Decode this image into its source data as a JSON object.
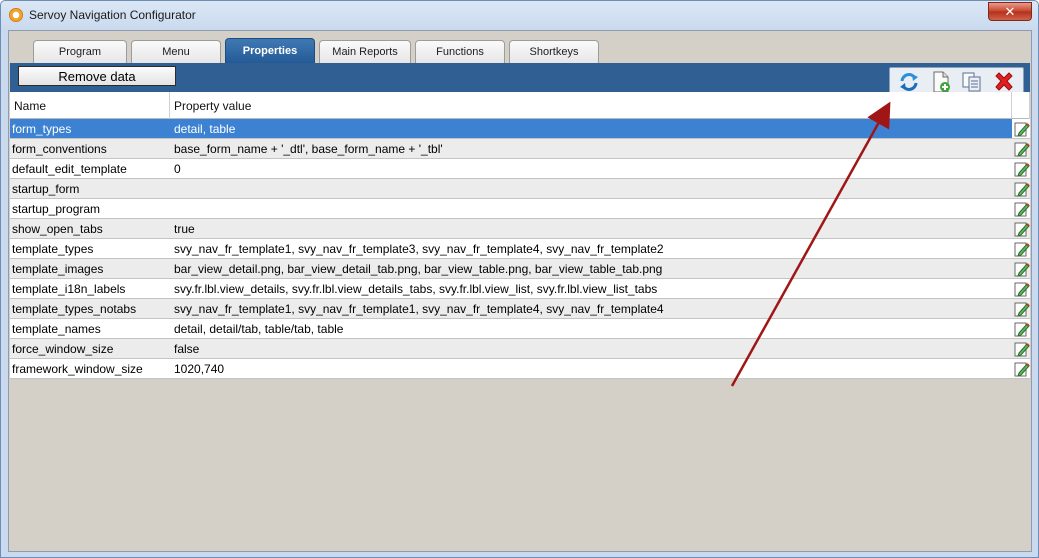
{
  "window": {
    "title": "Servoy Navigation Configurator",
    "close_label": "✕"
  },
  "tabs": [
    {
      "label": "Program",
      "width": 94,
      "active": false
    },
    {
      "label": "Menu",
      "width": 90,
      "active": false
    },
    {
      "label": "Properties",
      "width": 90,
      "active": true
    },
    {
      "label": "Main Reports",
      "width": 92,
      "active": false
    },
    {
      "label": "Functions",
      "width": 90,
      "active": false
    },
    {
      "label": "Shortkeys",
      "width": 90,
      "active": false
    }
  ],
  "remove_button_label": "Remove data",
  "toolbar_icons": [
    "refresh-icon",
    "add-document-icon",
    "copy-icon",
    "delete-icon"
  ],
  "table": {
    "headers": {
      "name": "Name",
      "value": "Property value"
    },
    "rows": [
      {
        "name": "form_types",
        "value": "detail, table"
      },
      {
        "name": "form_conventions",
        "value": "base_form_name + '_dtl', base_form_name + '_tbl'"
      },
      {
        "name": "default_edit_template",
        "value": "0"
      },
      {
        "name": "startup_form",
        "value": ""
      },
      {
        "name": "startup_program",
        "value": ""
      },
      {
        "name": "show_open_tabs",
        "value": "true"
      },
      {
        "name": "template_types",
        "value": "svy_nav_fr_template1, svy_nav_fr_template3, svy_nav_fr_template4, svy_nav_fr_template2"
      },
      {
        "name": "template_images",
        "value": "bar_view_detail.png, bar_view_detail_tab.png, bar_view_table.png, bar_view_table_tab.png"
      },
      {
        "name": "template_i18n_labels",
        "value": "svy.fr.lbl.view_details, svy.fr.lbl.view_details_tabs, svy.fr.lbl.view_list, svy.fr.lbl.view_list_tabs"
      },
      {
        "name": "template_types_notabs",
        "value": "svy_nav_fr_template1, svy_nav_fr_template1, svy_nav_fr_template4, svy_nav_fr_template4"
      },
      {
        "name": "template_names",
        "value": "detail, detail/tab, table/tab, table"
      },
      {
        "name": "force_window_size",
        "value": "false"
      },
      {
        "name": "framework_window_size",
        "value": "1020,740"
      }
    ],
    "selected_index": 0
  },
  "colors": {
    "accent_bar": "#2f5f93",
    "selection": "#3d82d2",
    "annotation_arrow": "#a01515"
  }
}
